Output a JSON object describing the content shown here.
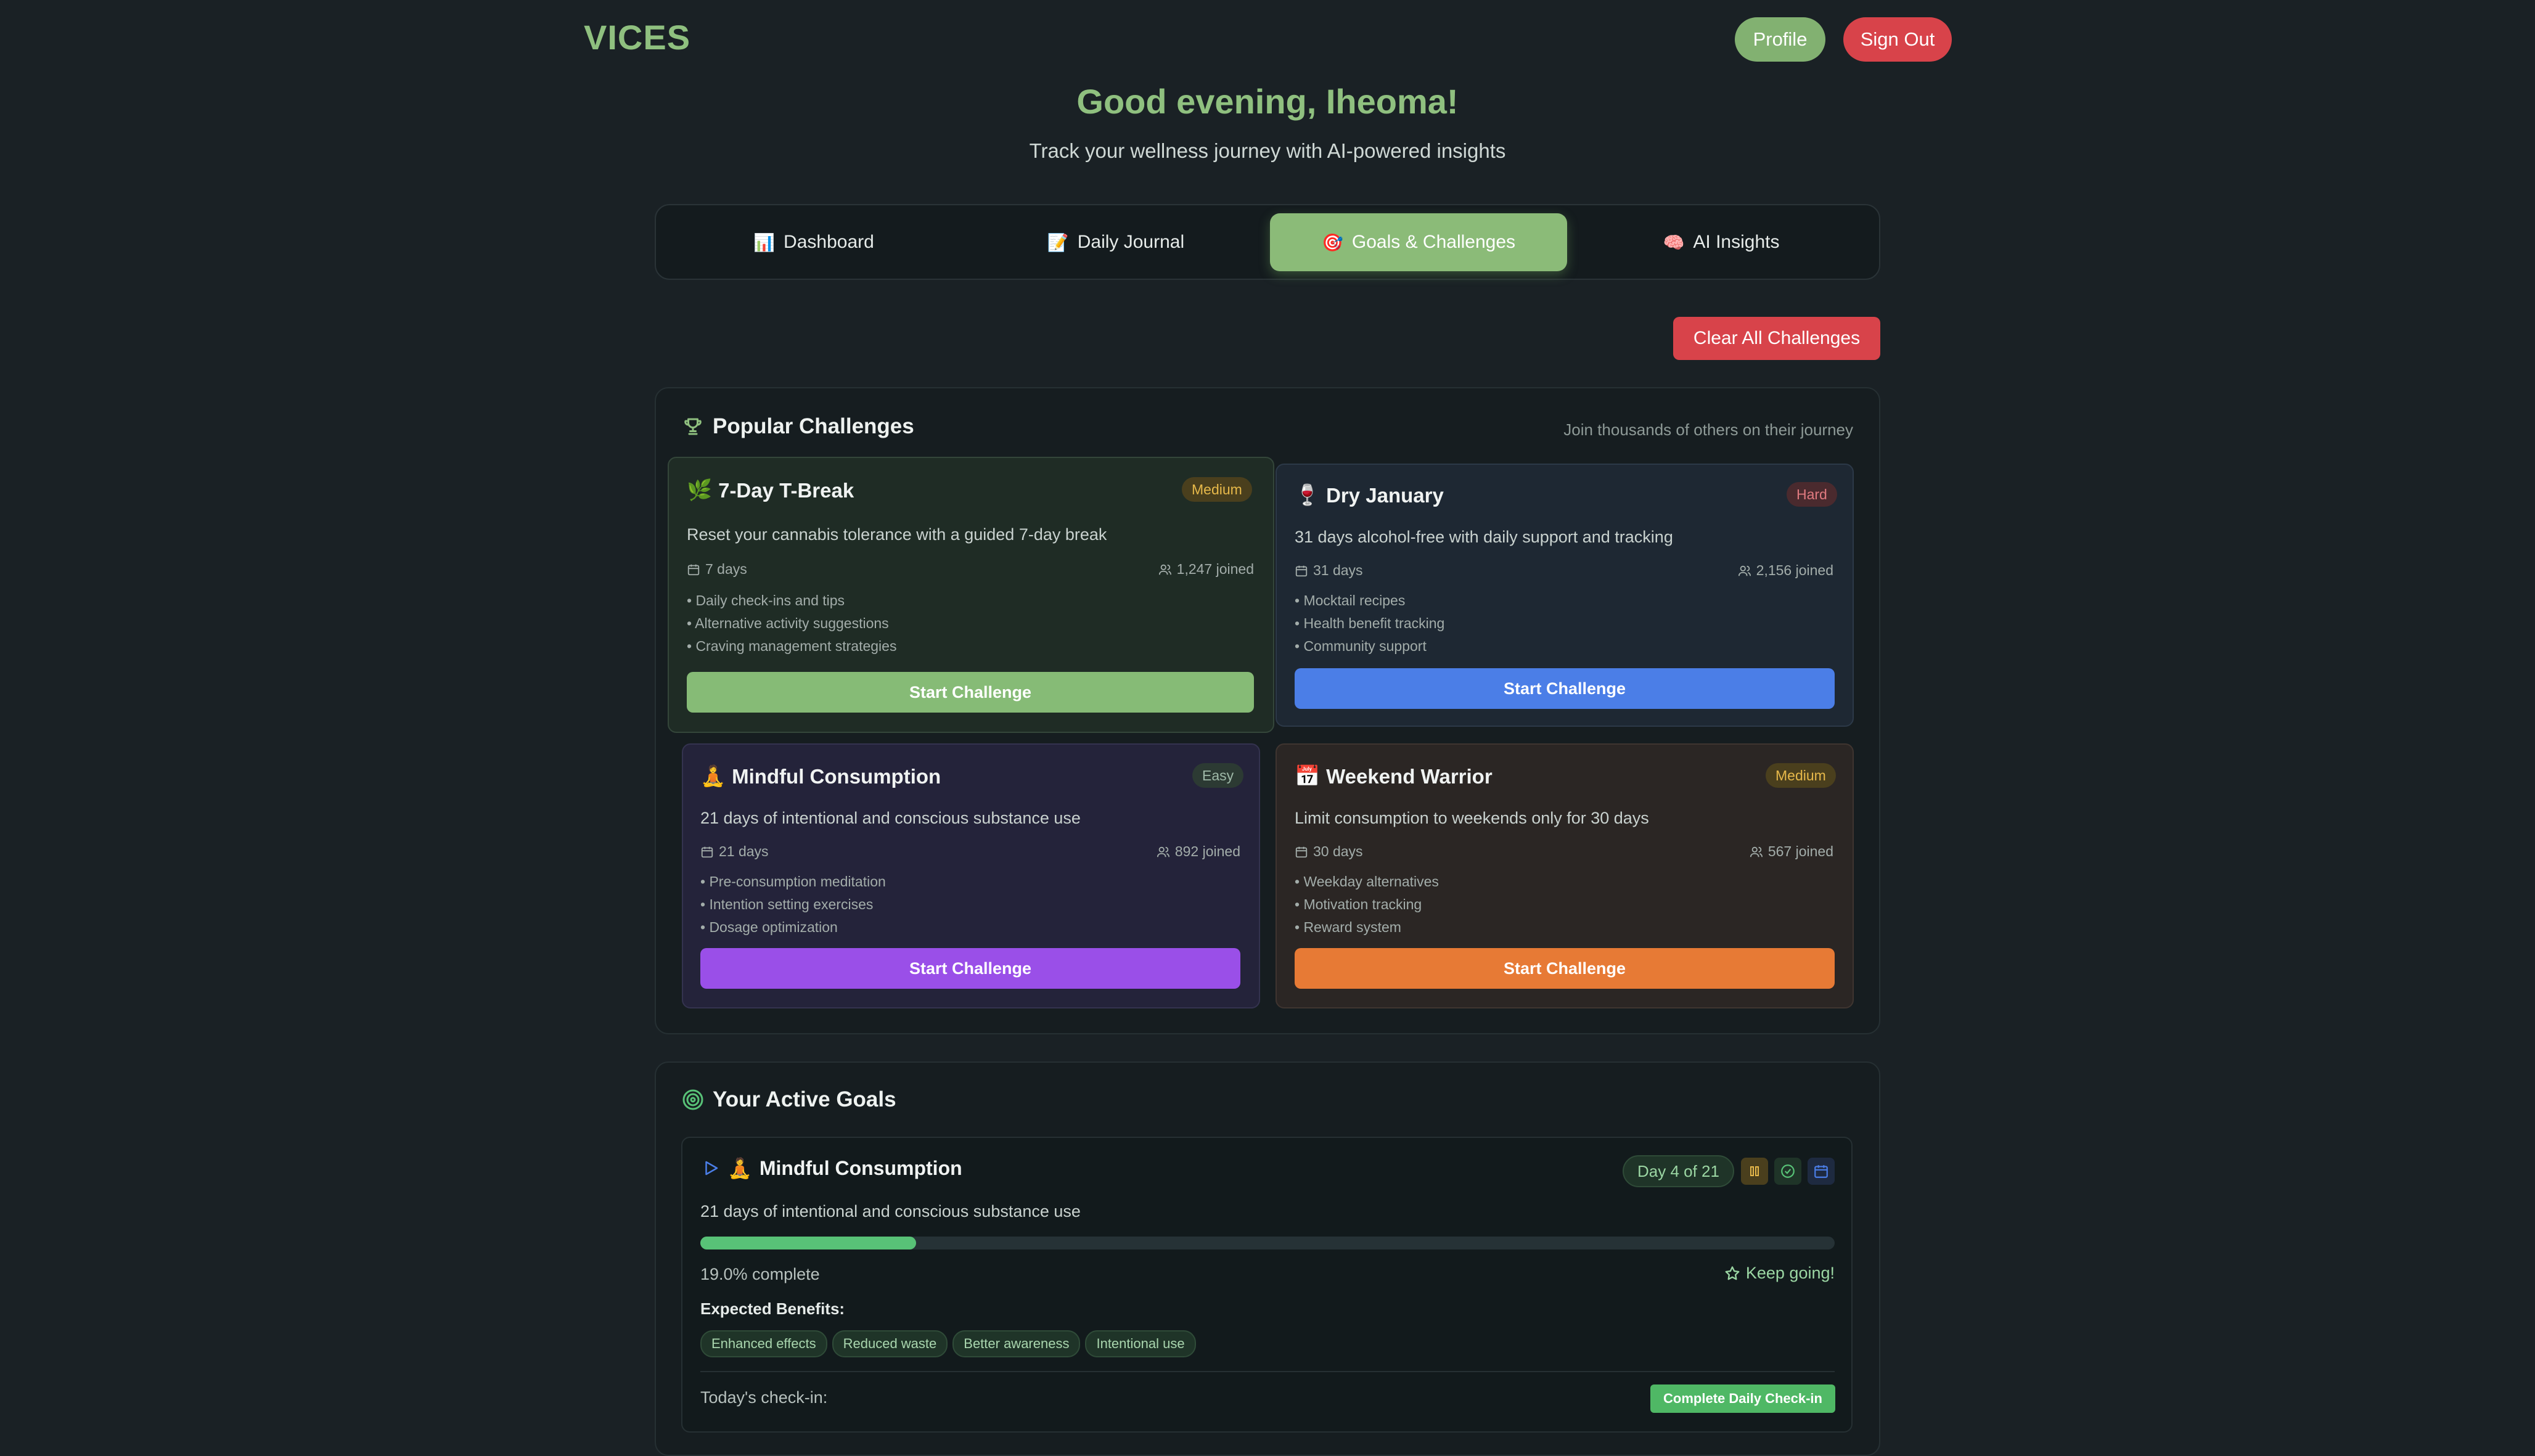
{
  "header": {
    "logo": "VICES",
    "profile_label": "Profile",
    "signout_label": "Sign Out"
  },
  "greeting": "Good evening, Iheoma!",
  "subtitle": "Track your wellness journey with AI-powered insights",
  "tabs": [
    {
      "icon": "📊",
      "label": "Dashboard"
    },
    {
      "icon": "📝",
      "label": "Daily Journal"
    },
    {
      "icon": "🎯",
      "label": "Goals & Challenges",
      "active": true
    },
    {
      "icon": "🧠",
      "label": "AI Insights"
    }
  ],
  "clear_label": "Clear All Challenges",
  "popular": {
    "title": "Popular Challenges",
    "note": "Join thousands of others on their journey",
    "cards": [
      {
        "icon": "🌿",
        "title": "7-Day T-Break",
        "difficulty": "Medium",
        "desc": "Reset your cannabis tolerance with a guided 7-day break",
        "days": "7 days",
        "joined": "1,247 joined",
        "features": [
          "• Daily check-ins and tips",
          "• Alternative activity suggestions",
          "• Craving management strategies"
        ],
        "button": "Start Challenge"
      },
      {
        "icon": "🍷",
        "title": "Dry January",
        "difficulty": "Hard",
        "desc": "31 days alcohol-free with daily support and tracking",
        "days": "31 days",
        "joined": "2,156 joined",
        "features": [
          "• Mocktail recipes",
          "• Health benefit tracking",
          "• Community support"
        ],
        "button": "Start Challenge"
      },
      {
        "icon": "🧘",
        "title": "Mindful Consumption",
        "difficulty": "Easy",
        "desc": "21 days of intentional and conscious substance use",
        "days": "21 days",
        "joined": "892 joined",
        "features": [
          "• Pre-consumption meditation",
          "• Intention setting exercises",
          "• Dosage optimization"
        ],
        "button": "Start Challenge"
      },
      {
        "icon": "📅",
        "title": "Weekend Warrior",
        "difficulty": "Medium",
        "desc": "Limit consumption to weekends only for 30 days",
        "days": "30 days",
        "joined": "567 joined",
        "features": [
          "• Weekday alternatives",
          "• Motivation tracking",
          "• Reward system"
        ],
        "button": "Start Challenge"
      }
    ]
  },
  "goals": {
    "title": "Your Active Goals",
    "goal": {
      "icon": "🧘",
      "title": "Mindful Consumption",
      "day_label": "Day 4 of 21",
      "desc": "21 days of intentional and conscious substance use",
      "progress": 0.19,
      "progress_text": "19.0% complete",
      "keep_going": "Keep going!",
      "benefits_label": "Expected Benefits:",
      "benefits": [
        "Enhanced effects",
        "Reduced waste",
        "Better awareness",
        "Intentional use"
      ],
      "checkin_label": "Today's check-in:",
      "checkin_button": "Complete Daily Check-in"
    }
  },
  "colors": {
    "accent_green": "#8fc07f",
    "danger_red": "#d8434a",
    "blue": "#4b7ee7",
    "purple": "#9a4fe8",
    "orange": "#e77a35",
    "progress": "#58c277"
  }
}
